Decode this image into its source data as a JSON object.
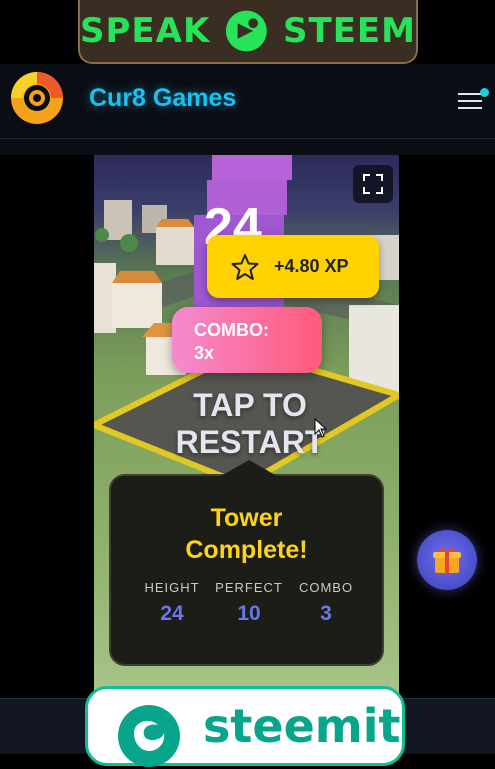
{
  "banner": {
    "left_word": "SPEAK",
    "right_word": "STEEM"
  },
  "header": {
    "title": "Cur8 Games"
  },
  "game": {
    "score": "24",
    "xp": "+4.80 XP",
    "combo_line1": "COMBO:",
    "combo_line2": "3x",
    "restart_line1": "TAP TO",
    "restart_line2": "RESTART",
    "result": {
      "title_line1": "Tower",
      "title_line2": "Complete!",
      "stats": [
        {
          "label": "HEIGHT",
          "value": "24"
        },
        {
          "label": "PERFECT",
          "value": "10"
        },
        {
          "label": "COMBO",
          "value": "3"
        }
      ]
    }
  },
  "footer": {
    "steemit_word": "steemit"
  },
  "colors": {
    "accent": "#18c2f0",
    "xp_badge": "#ffd200",
    "result_title": "#ffd214",
    "stat_value": "#6878e8",
    "steemit_green": "#07a58b"
  },
  "icons": [
    "speak-steem-logo-icon",
    "cur8-logo-icon",
    "menu-icon",
    "fullscreen-icon",
    "star-icon",
    "cursor-icon",
    "gift-icon",
    "steemit-logo-icon"
  ]
}
